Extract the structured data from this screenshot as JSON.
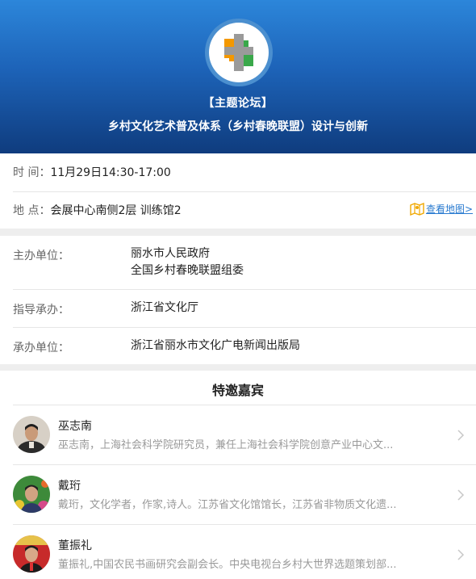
{
  "header": {
    "tag": "【主题论坛】",
    "title": "乡村文化艺术普及体系（乡村春晚联盟）设计与创新"
  },
  "event": {
    "time_label": "时 间：",
    "time_value": "11月29日14:30-17:00",
    "place_label": "地 点：",
    "place_value": "会展中心南侧2层 训练馆2",
    "map_link": "查看地图>"
  },
  "organizers": {
    "host_label": "主办单位：",
    "host_values": [
      "丽水市人民政府",
      "全国乡村春晚联盟组委"
    ],
    "guide_label": "指导承办：",
    "guide_value": "浙江省文化厅",
    "undertake_label": "承办单位：",
    "undertake_value": "浙江省丽水市文化广电新闻出版局"
  },
  "guests": {
    "title": "特邀嘉宾",
    "items": [
      {
        "name": "巫志南",
        "desc": "巫志南，上海社会科学院研究员，兼任上海社会科学院创意产业中心文..."
      },
      {
        "name": "戴珩",
        "desc": "戴珩，文化学者，作家,诗人。江苏省文化馆馆长，江苏省非物质文化遗..."
      },
      {
        "name": "董振礼",
        "desc": "董振礼,中国农民书画研究会副会长。中央电视台乡村大世界选题策划部..."
      }
    ]
  },
  "colors": {
    "header_top": "#2c86da",
    "header_bottom": "#0f3c7e",
    "link": "#2a7bd0",
    "map_icon": "#f0a800"
  },
  "icons": {
    "logo": "forum-logo-icon",
    "map": "map-book-icon",
    "chevron": "chevron-right-icon"
  }
}
